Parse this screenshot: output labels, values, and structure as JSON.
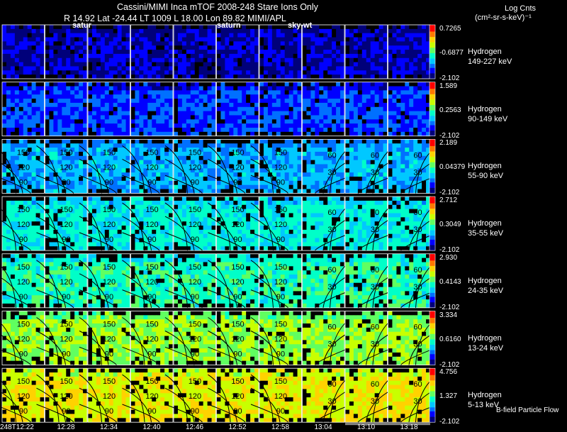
{
  "header": {
    "title_line": "Cassini/MIMI Inca mTOF  2008-248   Stare   Ions Only",
    "position_line": "R       14.92 Lat -24.44 LT 1009 L         18.00 Lon         89.82  MIMI/APL",
    "colorbar_title_1": "Log Cnts",
    "colorbar_title_2": "(cm²-sr-s-keV)⁻¹"
  },
  "overlay_labels": {
    "label_saturn_1": "satur",
    "label_saturn_2": "saturn",
    "label_sky": "sky-wt"
  },
  "footer": {
    "bfield_label": "B-field Particle Flow"
  },
  "chart_data": {
    "type": "heatmap",
    "title": "Cassini/MIMI Inca mTOF  2008-248   Stare   Ions Only",
    "time_labels": [
      "248T12:22",
      "12:28",
      "12:34",
      "12:40",
      "12:46",
      "12:52",
      "12:58",
      "13:04",
      "13:10",
      "13:18"
    ],
    "contour_labels": [
      "150",
      "120",
      "90",
      "60",
      "30"
    ],
    "channels": [
      {
        "species": "Hydrogen",
        "energy": "149-227 keV",
        "cmax": "0.7265",
        "cmid": "-0.6877",
        "cmin": "-2.102",
        "level": 0.1
      },
      {
        "species": "Hydrogen",
        "energy": "90-149 keV",
        "cmax": "1.589",
        "cmid": "0.2563",
        "cmin": "-2.102",
        "level": 0.2
      },
      {
        "species": "Hydrogen",
        "energy": "55-90 keV",
        "cmax": "2.189",
        "cmid": "0.04379",
        "cmin": "-2.102",
        "level": 0.33
      },
      {
        "species": "Hydrogen",
        "energy": "35-55 keV",
        "cmax": "2.712",
        "cmid": "0.3049",
        "cmin": "-2.102",
        "level": 0.42
      },
      {
        "species": "Hydrogen",
        "energy": "24-35 keV",
        "cmax": "2.930",
        "cmid": "0.4143",
        "cmin": "-2.102",
        "level": 0.47
      },
      {
        "species": "Hydrogen",
        "energy": "13-24 keV",
        "cmax": "3.334",
        "cmid": "0.6160",
        "cmin": "-2.102",
        "level": 0.6
      },
      {
        "species": "Hydrogen",
        "energy": "5-13 keV",
        "cmax": "4.756",
        "cmid": "1.327",
        "cmin": "-2.102",
        "level": 0.7
      }
    ],
    "colormap": [
      "#00007a",
      "#0000ff",
      "#0070ff",
      "#00c8ff",
      "#00ffc8",
      "#60ff60",
      "#c8ff00",
      "#ffd200",
      "#ff7800",
      "#ff0000"
    ]
  }
}
